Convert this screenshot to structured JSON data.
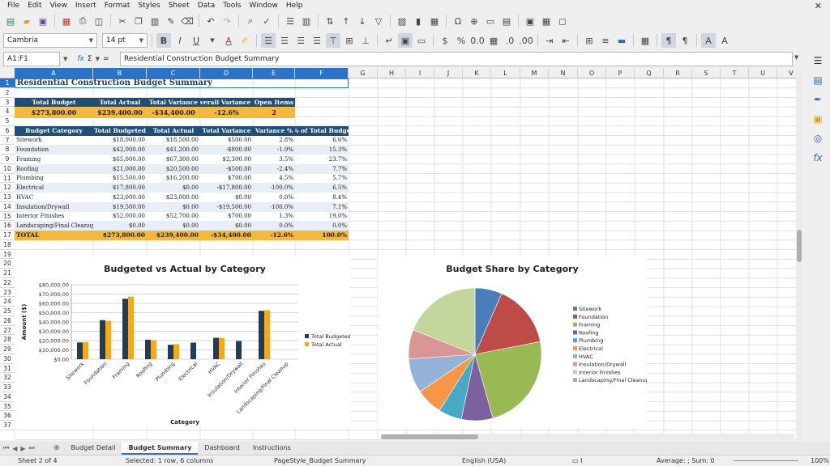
{
  "menu": [
    "File",
    "Edit",
    "View",
    "Insert",
    "Format",
    "Styles",
    "Sheet",
    "Data",
    "Tools",
    "Window",
    "Help"
  ],
  "toolbar": {
    "font_name": "Cambria",
    "font_size": "14 pt"
  },
  "formula": {
    "cell_ref": "A1:F1",
    "content": "Residential Construction Budget Summary"
  },
  "columns": [
    "A",
    "B",
    "C",
    "D",
    "E",
    "F",
    "G",
    "H",
    "I",
    "J",
    "K",
    "L",
    "M",
    "N",
    "O",
    "P",
    "Q",
    "R",
    "S",
    "T",
    "U",
    "V"
  ],
  "rows": [
    "1",
    "2",
    "3",
    "4",
    "5",
    "6",
    "7",
    "8",
    "9",
    "10",
    "11",
    "12",
    "13",
    "14",
    "15",
    "16",
    "17",
    "18",
    "19",
    "20",
    "21",
    "22",
    "23",
    "24",
    "25",
    "26",
    "27",
    "28",
    "29",
    "30",
    "31",
    "32",
    "33",
    "34",
    "35",
    "36",
    "37"
  ],
  "sheet": {
    "title": "Residential Construction Budget Summary",
    "summary_headers": [
      "Total Budget",
      "Total Actual",
      "Total Variance",
      "Overall Variance %",
      "Open Items"
    ],
    "summary_values": [
      "$273,800.00",
      "$239,400.00",
      "-$34,400.00",
      "-12.6%",
      "2"
    ],
    "table_headers": [
      "Budget Category",
      "Total Budgeted",
      "Total Actual",
      "Total Variance",
      "Variance %",
      "% of Total Budge"
    ],
    "table_rows": [
      [
        "Sitework",
        "$18,000.00",
        "$18,500.00",
        "$500.00",
        "2.8%",
        "6.6%"
      ],
      [
        "Foundation",
        "$42,000.00",
        "$41,200.00",
        "-$800.00",
        "-1.9%",
        "15.3%"
      ],
      [
        "Framing",
        "$65,000.00",
        "$67,300.00",
        "$2,300.00",
        "3.5%",
        "23.7%"
      ],
      [
        "Roofing",
        "$21,000.00",
        "$20,500.00",
        "-$500.00",
        "-2.4%",
        "7.7%"
      ],
      [
        "Plumbing",
        "$15,500.00",
        "$16,200.00",
        "$700.00",
        "4.5%",
        "5.7%"
      ],
      [
        "Electrical",
        "$17,800.00",
        "$0.00",
        "-$17,800.00",
        "-100.0%",
        "6.5%"
      ],
      [
        "HVAC",
        "$23,000.00",
        "$23,000.00",
        "$0.00",
        "0.0%",
        "8.4%"
      ],
      [
        "Insulation/Drywall",
        "$19,500.00",
        "$0.00",
        "-$19,500.00",
        "-100.0%",
        "7.1%"
      ],
      [
        "Interior Finishes",
        "$52,000.00",
        "$52,700.00",
        "$700.00",
        "1.3%",
        "19.0%"
      ],
      [
        "Landscaping/Final Cleanup",
        "$0.00",
        "$0.00",
        "$0.00",
        "0.0%",
        "0.0%"
      ]
    ],
    "total_row": [
      "TOTAL",
      "$273,800.00",
      "$239,400.00",
      "-$34,400.00",
      "-12.6%",
      "100.0%"
    ]
  },
  "chart_data": [
    {
      "type": "bar",
      "title": "Budgeted vs Actual by Category",
      "xlabel": "Category",
      "ylabel": "Amount ($)",
      "categories": [
        "Sitework",
        "Foundation",
        "Framing",
        "Roofing",
        "Plumbing",
        "Electrical",
        "HVAC",
        "Insulation/Drywall",
        "Interior Finishes",
        "Landscaping/Final Cleanup"
      ],
      "series": [
        {
          "name": "Total Budgeted",
          "color": "#1f3d5a",
          "values": [
            18000,
            42000,
            65000,
            21000,
            15500,
            17800,
            23000,
            19500,
            52000,
            0
          ]
        },
        {
          "name": "Total Actual",
          "color": "#f4a81d",
          "values": [
            18500,
            41200,
            67300,
            20500,
            16200,
            0,
            23000,
            0,
            52700,
            0
          ]
        }
      ],
      "ylim": [
        0,
        80000
      ],
      "yticks": [
        "$0.00",
        "$10,000.00",
        "$20,000.00",
        "$30,000.00",
        "$40,000.00",
        "$50,000.00",
        "$60,000.00",
        "$70,000.00",
        "$80,000.00"
      ],
      "legend": "right",
      "grid": true
    },
    {
      "type": "pie",
      "title": "Budget Share by Category",
      "categories": [
        "Sitework",
        "Foundation",
        "Framing",
        "Roofing",
        "Plumbing",
        "Electrical",
        "HVAC",
        "Insulation/Drywall",
        "Interior Finishes",
        "Landscaping/Final Cleanup"
      ],
      "values": [
        18000,
        42000,
        65000,
        21000,
        15500,
        17800,
        23000,
        19500,
        52000,
        0
      ],
      "colors": [
        "#4a7ebb",
        "#be4b48",
        "#98b954",
        "#7d60a0",
        "#46aac5",
        "#f79646",
        "#95b3d7",
        "#d99694",
        "#c3d69b",
        "#b3a2c7"
      ],
      "legend": "right"
    }
  ],
  "tabs": [
    "Budget Detail",
    "Budget Summary",
    "Dashboard",
    "Instructions"
  ],
  "active_tab": "Budget Summary",
  "status": {
    "sheet": "Sheet 2 of 4",
    "selection": "Selected: 1 row, 6 columns",
    "page_style": "PageStyle_Budget Summary",
    "language": "English (USA)",
    "summary": "Average: ; Sum: 0",
    "zoom": "100%"
  }
}
